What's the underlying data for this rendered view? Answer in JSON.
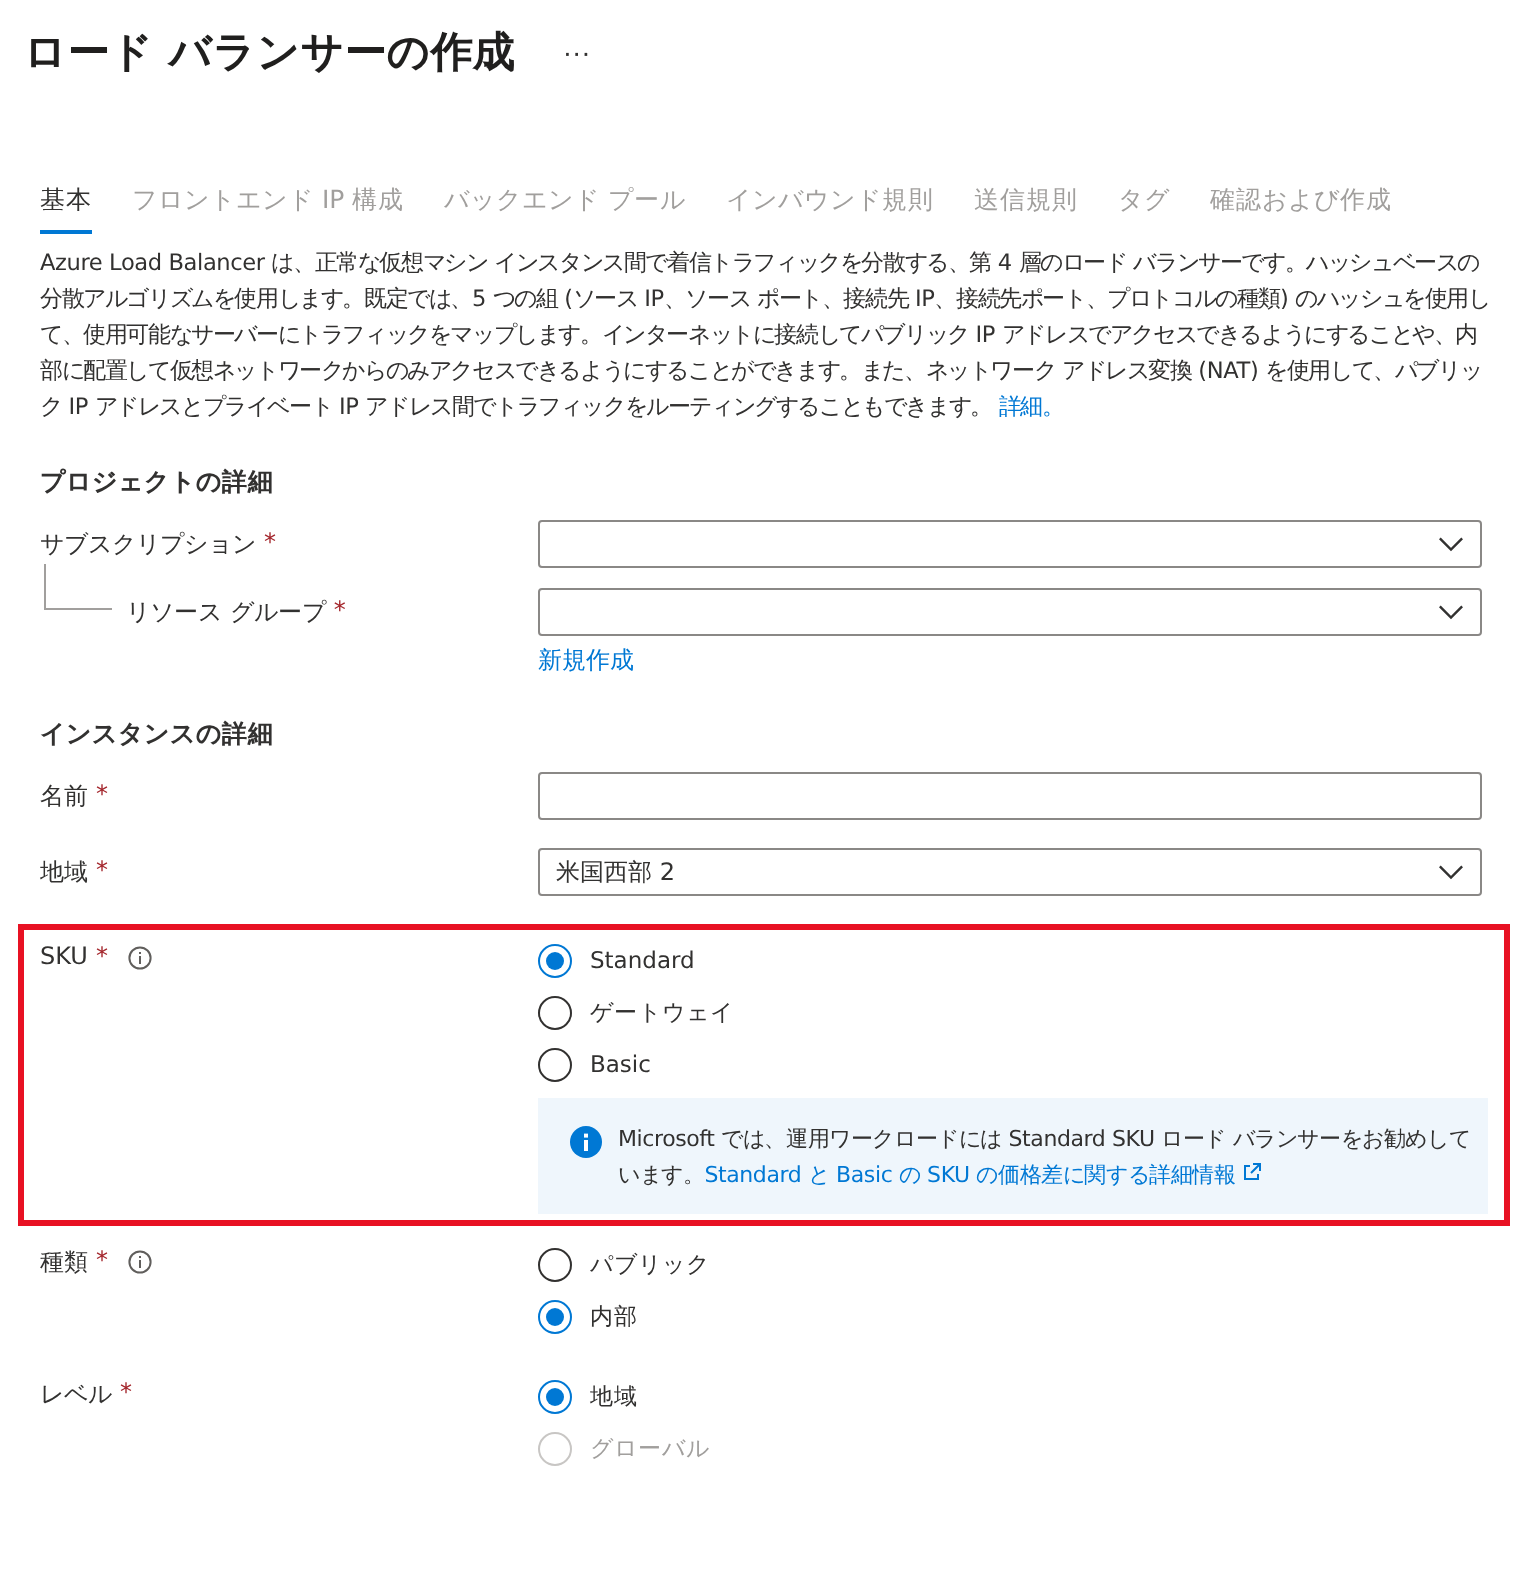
{
  "title": "ロード バランサーの作成",
  "more_button": "···",
  "tabs": [
    {
      "label": "基本",
      "selected": true
    },
    {
      "label": "フロントエンド IP 構成",
      "selected": false
    },
    {
      "label": "バックエンド プール",
      "selected": false
    },
    {
      "label": "インバウンド規則",
      "selected": false
    },
    {
      "label": "送信規則",
      "selected": false
    },
    {
      "label": "タグ",
      "selected": false
    },
    {
      "label": "確認および作成",
      "selected": false
    }
  ],
  "description": {
    "text": "Azure Load Balancer は、正常な仮想マシン インスタンス間で着信トラフィックを分散する、第 4 層のロード バランサーです。ハッシュベースの分散アルゴリズムを使用します。既定では、5 つの組 (ソース IP、ソース ポート、接続先 IP、接続先ポート、プロトコルの種類) のハッシュを使用して、使用可能なサーバーにトラフィックをマップします。インターネットに接続してパブリック IP アドレスでアクセスできるようにすることや、内部に配置して仮想ネットワークからのみアクセスできるようにすることができます。また、ネットワーク アドレス変換 (NAT) を使用して、パブリック IP アドレスとプライベート IP アドレス間でトラフィックをルーティングすることもできます。",
    "link": "詳細。"
  },
  "sections": [
    {
      "heading": "プロジェクトの詳細",
      "fields": [
        {
          "kind": "dropdown",
          "label": "サブスクリプション",
          "required_mark": "*",
          "children": [
            {
              "kind": "dropdown",
              "label": "リソース グループ",
              "required_mark": "*",
              "link": "新規作成"
            }
          ]
        }
      ]
    },
    {
      "heading": "インスタンスの詳細",
      "fields": [
        {
          "kind": "text",
          "label": "名前",
          "required_mark": "*"
        },
        {
          "kind": "dropdown",
          "label": "地域",
          "required_mark": "*",
          "value": "米国西部 2"
        },
        {
          "kind": "radio",
          "label": "SKU",
          "required_mark": "*",
          "info": true,
          "highlighted": true,
          "options": [
            {
              "label": "Standard",
              "selected": true,
              "disabled": false
            },
            {
              "label": "ゲートウェイ",
              "selected": false,
              "disabled": false
            },
            {
              "label": "Basic",
              "selected": false,
              "disabled": false
            }
          ],
          "notice": {
            "text": "Microsoft では、運用ワークロードには Standard SKU ロード バランサーをお勧めしています。",
            "link": "Standard と Basic の SKU の価格差に関する詳細情報"
          }
        },
        {
          "kind": "radio",
          "label": "種類",
          "required_mark": "*",
          "info": true,
          "highlighted": false,
          "options": [
            {
              "label": "パブリック",
              "selected": false,
              "disabled": false
            },
            {
              "label": "内部",
              "selected": true,
              "disabled": false
            }
          ]
        },
        {
          "kind": "radio",
          "label": "レベル",
          "required_mark": "*",
          "info": false,
          "highlighted": false,
          "options": [
            {
              "label": "地域",
              "selected": true,
              "disabled": false
            },
            {
              "label": "グローバル",
              "selected": false,
              "disabled": true
            }
          ]
        }
      ]
    }
  ]
}
